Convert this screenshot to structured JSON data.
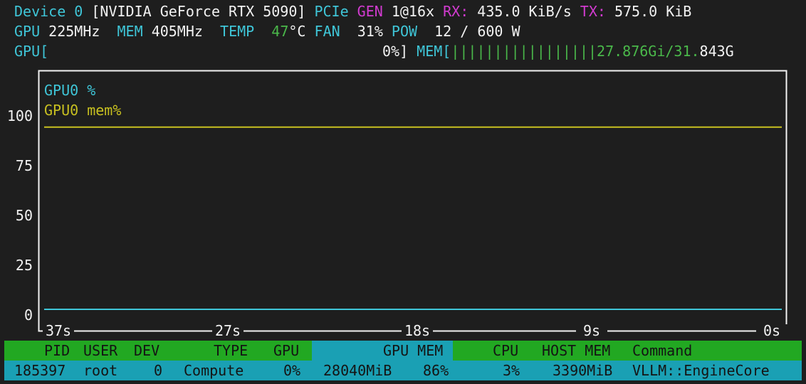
{
  "device": {
    "label": "Device 0",
    "name": "[NVIDIA GeForce RTX 5090]",
    "pcie_label": "PCIe",
    "gen_label": "GEN",
    "gen_value": "1@16x",
    "rx_label": "RX:",
    "rx_value": "435.0 KiB/s",
    "tx_label": "TX:",
    "tx_value": "575.0 KiB"
  },
  "stats": {
    "gpu_label": "GPU",
    "gpu_clock": "225MHz",
    "mem_label": "MEM",
    "mem_clock": "405MHz",
    "temp_label": "TEMP",
    "temp_value": "47",
    "temp_unit": "°C",
    "fan_label": "FAN",
    "fan_value": "31%",
    "pow_label": "POW",
    "pow_value": "12 / 600 W"
  },
  "bars": {
    "gpu_label": "GPU[",
    "gpu_value": "0%]",
    "gpu_fraction": 0.0,
    "mem_label": "MEM[",
    "mem_bars": "|||||||||||||||||",
    "mem_used": "27.876Gi/31.",
    "mem_total_tail": "843G",
    "mem_fraction": 0.875
  },
  "chart_data": {
    "type": "line",
    "x_ticks": [
      "37s",
      "27s",
      "18s",
      "9s",
      "0s"
    ],
    "y_ticks": [
      "100",
      "75",
      "50",
      "25",
      "0"
    ],
    "ylim": [
      0,
      100
    ],
    "series": [
      {
        "name": "GPU0 %",
        "color": "#3fc6d8",
        "values": [
          0,
          0
        ]
      },
      {
        "name": "GPU0 mem%",
        "color": "#c8c020",
        "values": [
          91.5,
          91.5
        ]
      }
    ]
  },
  "processes": {
    "headers": [
      "PID",
      "USER",
      "DEV",
      "TYPE",
      "GPU",
      "GPU MEM",
      "CPU",
      "HOST MEM",
      "Command"
    ],
    "rows": [
      {
        "pid": "185397",
        "user": "root",
        "dev": "0",
        "type": "Compute",
        "gpu": "0%",
        "gpu_mem": "28040MiB",
        "gpu_mem_pct": "86%",
        "cpu": "3%",
        "host_mem": "3390MiB",
        "command": "VLLM::EngineCore"
      }
    ]
  }
}
